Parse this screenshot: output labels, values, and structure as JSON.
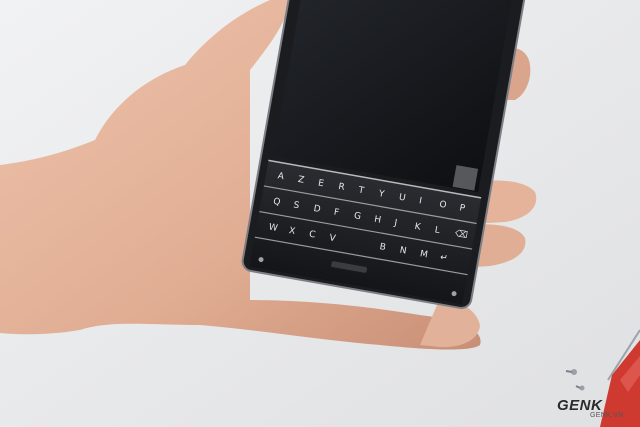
{
  "watermark": {
    "brand": "GENK",
    "site": "GENK.VN"
  },
  "keyboard": {
    "rows": [
      [
        "A",
        "Z",
        "E",
        "R",
        "T",
        "Y",
        "U",
        "I",
        "O",
        "P"
      ],
      [
        "Q",
        "S",
        "D",
        "F",
        "G",
        "H",
        "J",
        "K",
        "L",
        "⌫"
      ],
      [
        "W",
        "X",
        "C",
        "V",
        "",
        "B",
        "N",
        "M",
        "↵"
      ]
    ]
  },
  "colors": {
    "background": "#e9eaec",
    "device_body": "#1c1d21",
    "screen": "#121418",
    "skin": "#e3b49b",
    "screwdriver": "#d0342c"
  }
}
